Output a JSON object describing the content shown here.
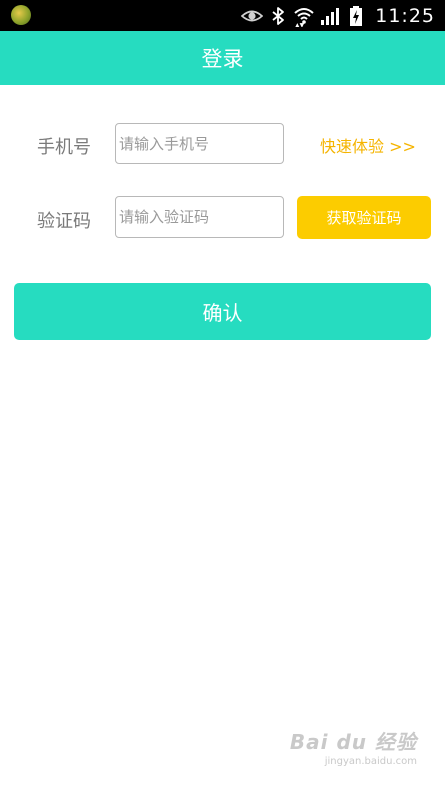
{
  "status_bar": {
    "time": "11:25",
    "icons": [
      "app-notification-icon",
      "eye-icon",
      "bluetooth-icon",
      "wifi-icon",
      "signal-icon",
      "battery-charging-icon"
    ]
  },
  "header": {
    "title": "登录"
  },
  "form": {
    "phone": {
      "label": "手机号",
      "placeholder": "请输入手机号",
      "value": ""
    },
    "quick_link": "快速体验 >>",
    "code": {
      "label": "验证码",
      "placeholder": "请输入验证码",
      "value": ""
    },
    "get_code_button": "获取验证码",
    "confirm_button": "确认"
  },
  "watermark": {
    "main": "Bai du 经验",
    "sub": "jingyan.baidu.com"
  },
  "colors": {
    "accent": "#26dcc0",
    "code_button": "#fccc00",
    "quick_link": "#f5b400",
    "label": "#7a7a7a"
  }
}
